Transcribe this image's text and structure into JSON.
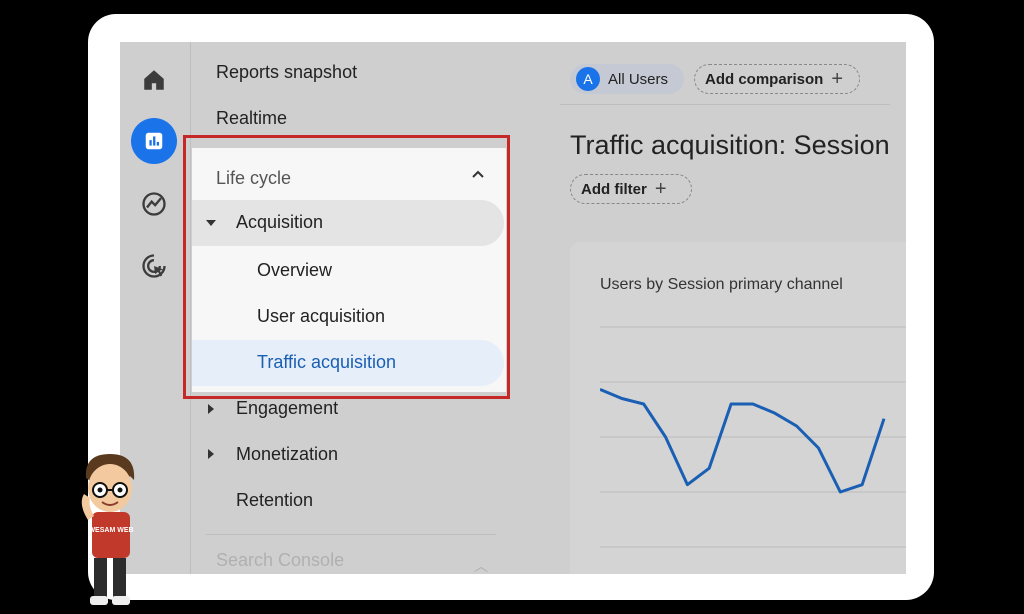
{
  "sidebar": {
    "items": [
      {
        "name": "home-icon"
      },
      {
        "name": "reports-icon",
        "active": true
      },
      {
        "name": "explore-icon"
      },
      {
        "name": "advertising-icon"
      }
    ]
  },
  "nav": {
    "reports_snapshot": "Reports snapshot",
    "realtime": "Realtime",
    "life_cycle": "Life cycle",
    "acquisition": "Acquisition",
    "overview": "Overview",
    "user_acquisition": "User acquisition",
    "traffic_acquisition": "Traffic acquisition",
    "engagement": "Engagement",
    "monetization": "Monetization",
    "retention": "Retention",
    "search_console": "Search Console"
  },
  "header": {
    "avatar_letter": "A",
    "all_users": "All Users",
    "add_comparison": "Add comparison",
    "page_title": "Traffic acquisition: Session",
    "add_filter": "Add filter"
  },
  "card": {
    "title": "Users by Session primary channel"
  },
  "chart_data": {
    "type": "line",
    "series": [
      {
        "values": [
          8.6,
          8.1,
          7.8,
          6.0,
          3.4,
          4.3,
          7.8,
          7.8,
          7.3,
          6.6,
          5.4,
          3.0,
          3.4,
          7.0
        ]
      }
    ],
    "ylim": [
      0,
      12
    ],
    "grid": true,
    "color": "#1a5fb4"
  },
  "decor": {
    "shirt_text": "WESAM WEB"
  },
  "colors": {
    "accent": "#1a73e8",
    "highlight_border": "#c62828",
    "link_blue": "#1a5fb4"
  }
}
